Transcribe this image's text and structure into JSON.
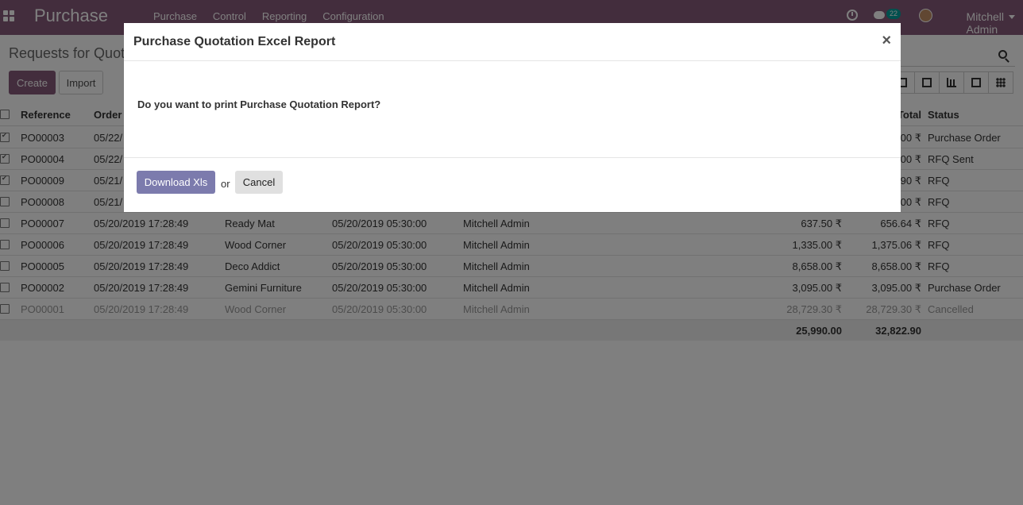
{
  "navbar": {
    "app_title": "Purchase",
    "menu": [
      "Purchase",
      "Control",
      "Reporting",
      "Configuration"
    ],
    "message_count": "22",
    "user_name": "Mitchell Admin"
  },
  "control_panel": {
    "title": "Requests for Quot",
    "create_label": "Create",
    "import_label": "Import"
  },
  "table": {
    "headers": {
      "reference": "Reference",
      "order_date": "Order",
      "total": "Total",
      "status": "Status"
    },
    "rows": [
      {
        "checked": true,
        "ref": "PO00003",
        "date": "05/22/",
        "vendor": "",
        "sched": "",
        "user": "",
        "untaxed": "",
        "total": "00 ₹",
        "status": "Purchase Order",
        "cancelled": false
      },
      {
        "checked": true,
        "ref": "PO00004",
        "date": "05/22/",
        "vendor": "",
        "sched": "",
        "user": "",
        "untaxed": "",
        "total": "00 ₹",
        "status": "RFQ Sent",
        "cancelled": false
      },
      {
        "checked": true,
        "ref": "PO00009",
        "date": "05/21/",
        "vendor": "",
        "sched": "",
        "user": "",
        "untaxed": "",
        "total": "90 ₹",
        "status": "RFQ",
        "cancelled": false
      },
      {
        "checked": false,
        "ref": "PO00008",
        "date": "05/21/",
        "vendor": "",
        "sched": "",
        "user": "",
        "untaxed": "",
        "total": "00 ₹",
        "status": "RFQ",
        "cancelled": false
      },
      {
        "checked": false,
        "ref": "PO00007",
        "date": "05/20/2019 17:28:49",
        "vendor": "Ready Mat",
        "sched": "05/20/2019 05:30:00",
        "user": "Mitchell Admin",
        "untaxed": "637.50 ₹",
        "total": "656.64 ₹",
        "status": "RFQ",
        "cancelled": false
      },
      {
        "checked": false,
        "ref": "PO00006",
        "date": "05/20/2019 17:28:49",
        "vendor": "Wood Corner",
        "sched": "05/20/2019 05:30:00",
        "user": "Mitchell Admin",
        "untaxed": "1,335.00 ₹",
        "total": "1,375.06 ₹",
        "status": "RFQ",
        "cancelled": false
      },
      {
        "checked": false,
        "ref": "PO00005",
        "date": "05/20/2019 17:28:49",
        "vendor": "Deco Addict",
        "sched": "05/20/2019 05:30:00",
        "user": "Mitchell Admin",
        "untaxed": "8,658.00 ₹",
        "total": "8,658.00 ₹",
        "status": "RFQ",
        "cancelled": false
      },
      {
        "checked": false,
        "ref": "PO00002",
        "date": "05/20/2019 17:28:49",
        "vendor": "Gemini Furniture",
        "sched": "05/20/2019 05:30:00",
        "user": "Mitchell Admin",
        "untaxed": "3,095.00 ₹",
        "total": "3,095.00 ₹",
        "status": "Purchase Order",
        "cancelled": false
      },
      {
        "checked": false,
        "ref": "PO00001",
        "date": "05/20/2019 17:28:49",
        "vendor": "Wood Corner",
        "sched": "05/20/2019 05:30:00",
        "user": "Mitchell Admin",
        "untaxed": "28,729.30 ₹",
        "total": "28,729.30 ₹",
        "status": "Cancelled",
        "cancelled": true
      }
    ],
    "footer": {
      "untaxed_sum": "25,990.00",
      "total_sum": "32,822.90"
    }
  },
  "dialog": {
    "title": "Purchase Quotation Excel Report",
    "close_symbol": "×",
    "question": "Do you want to print Purchase Quotation Report?",
    "download_label": "Download Xls",
    "or_label": "or",
    "cancel_label": "Cancel"
  }
}
